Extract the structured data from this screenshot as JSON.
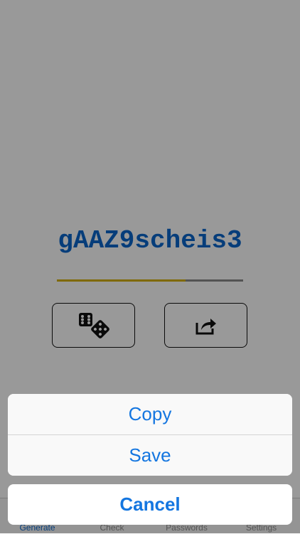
{
  "generator": {
    "password": "gAAZ9scheis3",
    "strength": 0.69,
    "colors": {
      "password_text": "#0a66cc",
      "strength_fill": "#d4b000",
      "strength_track": "#8a8a8a"
    }
  },
  "actions": {
    "dice_icon": "dice-icon",
    "share_icon": "share-icon"
  },
  "tabbar": {
    "tabs": [
      {
        "label": "Generate",
        "active": true
      },
      {
        "label": "Check",
        "active": false
      },
      {
        "label": "Passwords",
        "active": false
      },
      {
        "label": "Settings",
        "active": false
      }
    ]
  },
  "action_sheet": {
    "items": [
      {
        "label": "Copy"
      },
      {
        "label": "Save"
      }
    ],
    "cancel_label": "Cancel",
    "accent_color": "#1476e0"
  }
}
